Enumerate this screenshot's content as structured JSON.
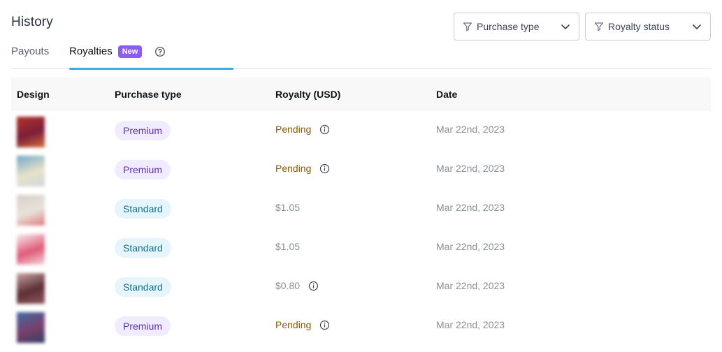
{
  "page": {
    "title": "History"
  },
  "filters": {
    "purchase_type": {
      "label": "Purchase type",
      "icon": "funnel-icon"
    },
    "royalty_status": {
      "label": "Royalty status",
      "icon": "funnel-icon"
    }
  },
  "tabs": {
    "payouts": "Payouts",
    "royalties": "Royalties",
    "new_badge": "New",
    "active": "royalties",
    "accent": "#3ab0e2"
  },
  "table": {
    "headers": {
      "design": "Design",
      "purchase_type": "Purchase type",
      "royalty": "Royalty (USD)",
      "date": "Date"
    },
    "rows": [
      {
        "purchase_type": "Premium",
        "royalty": "Pending",
        "royalty_info": true,
        "date": "Mar 22nd, 2023",
        "thumb_colors": [
          "#b2342a",
          "#7a1f3a",
          "#d96b3a"
        ]
      },
      {
        "purchase_type": "Premium",
        "royalty": "Pending",
        "royalty_info": true,
        "date": "Mar 22nd, 2023",
        "thumb_colors": [
          "#6fa7c9",
          "#e7e2c8",
          "#cfd8dd"
        ]
      },
      {
        "purchase_type": "Standard",
        "royalty": "$1.05",
        "royalty_info": false,
        "date": "Mar 22nd, 2023",
        "thumb_colors": [
          "#d8cfc6",
          "#e9e2dc",
          "#e07a7a"
        ]
      },
      {
        "purchase_type": "Standard",
        "royalty": "$1.05",
        "royalty_info": false,
        "date": "Mar 22nd, 2023",
        "thumb_colors": [
          "#f7eef0",
          "#e05a78",
          "#f2d7dd"
        ]
      },
      {
        "purchase_type": "Standard",
        "royalty": "$0.80",
        "royalty_info": true,
        "date": "Mar 22nd, 2023",
        "thumb_colors": [
          "#caa6a8",
          "#5c2f35",
          "#8d5a60"
        ]
      },
      {
        "purchase_type": "Premium",
        "royalty": "Pending",
        "royalty_info": true,
        "date": "Mar 22nd, 2023",
        "thumb_colors": [
          "#3f6aa8",
          "#7a3f6b",
          "#2f3f66"
        ]
      }
    ]
  }
}
